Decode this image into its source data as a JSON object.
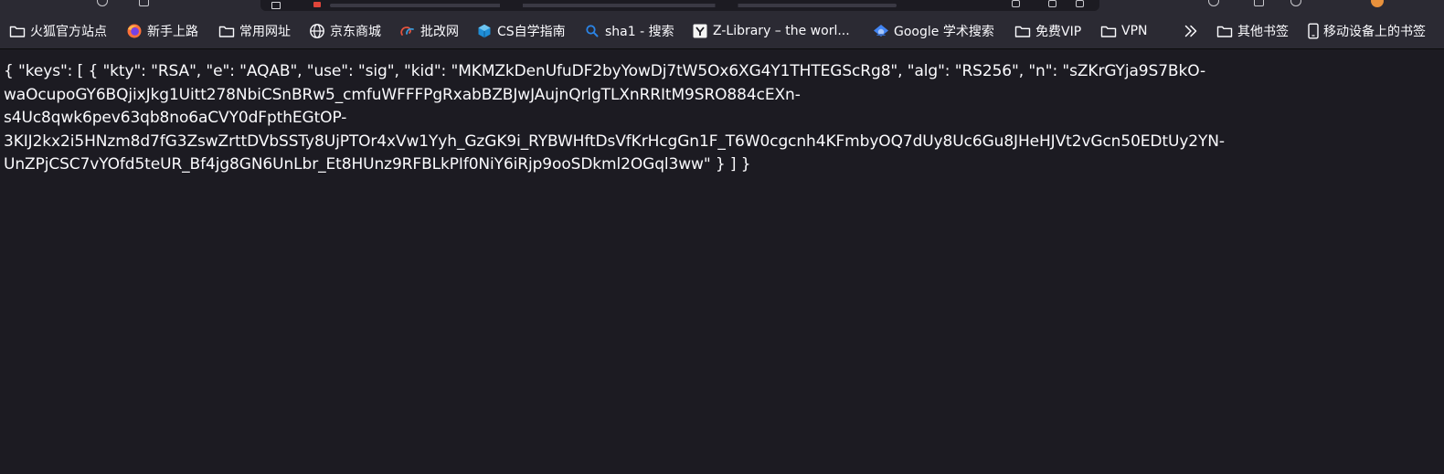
{
  "bookmarks": [
    {
      "label": "火狐官方站点",
      "icon": "folder-icon"
    },
    {
      "label": "新手上路",
      "icon": "firefox-icon"
    },
    {
      "label": "常用网址",
      "icon": "folder-icon"
    },
    {
      "label": "京东商城",
      "icon": "globe-icon"
    },
    {
      "label": "批改网",
      "icon": "pigai-icon"
    },
    {
      "label": "CS自学指南",
      "icon": "cube-icon"
    },
    {
      "label": "sha1 - 搜索",
      "icon": "search-icon"
    },
    {
      "label": "Z-Library – the worl...",
      "icon": "zlibrary-icon"
    },
    {
      "label": "Google 学术搜索",
      "icon": "scholar-icon"
    },
    {
      "label": "免费VIP",
      "icon": "folder-icon"
    },
    {
      "label": "VPN",
      "icon": "folder-icon"
    },
    {
      "label": "其他书签",
      "icon": "folder-icon"
    },
    {
      "label": "移动设备上的书签",
      "icon": "mobile-icon"
    }
  ],
  "overflow_icon": "chevron-double-right-icon",
  "json_text": {
    "lines": [
      "{ \"keys\": [ { \"kty\": \"RSA\", \"e\": \"AQAB\", \"use\": \"sig\", \"kid\": \"MKMZkDenUfuDF2byYowDj7tW5Ox6XG4Y1THTEGScRg8\", \"alg\": \"RS256\", \"n\": \"sZKrGYja9S7BkO-",
      "waOcupoGY6BQjixJkg1Uitt278NbiCSnBRw5_cmfuWFFFPgRxabBZBJwJAujnQrlgTLXnRRItM9SRO884cEXn-",
      "s4Uc8qwk6pev63qb8no6aCVY0dFpthEGtOP-",
      "3KIJ2kx2i5HNzm8d7fG3ZswZrttDVbSSTy8UjPTOr4xVw1Yyh_GzGK9i_RYBWHftDsVfKrHcgGn1F_T6W0cgcnh4KFmbyOQ7dUy8Uc6Gu8JHeHJVt2vGcn50EDtUy2YN-",
      "UnZPjCSC7vYOfd5teUR_Bf4jg8GN6UnLbr_Et8HUnz9RFBLkPIf0NiY6iRjp9ooSDkml2OGql3ww\" } ] }"
    ]
  }
}
